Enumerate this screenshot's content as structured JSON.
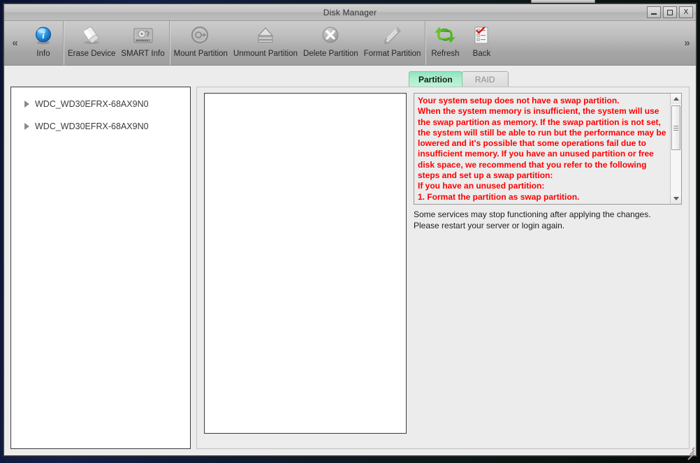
{
  "window": {
    "title": "Disk Manager",
    "buttons": {
      "minimize_label": "_",
      "maximize_label": "",
      "close_label": "X"
    }
  },
  "toolbar": {
    "scroll_left_label": "«",
    "scroll_right_label": "»",
    "groups": [
      {
        "items": [
          {
            "label": "Info",
            "icon": "info-icon"
          }
        ]
      },
      {
        "items": [
          {
            "label": "Erase Device",
            "icon": "eraser-icon"
          },
          {
            "label": "SMART Info",
            "icon": "harddisk-icon"
          }
        ]
      },
      {
        "items": [
          {
            "label": "Mount Partition",
            "icon": "plug-icon"
          },
          {
            "label": "Unmount Partition",
            "icon": "eject-icon"
          },
          {
            "label": "Delete Partition",
            "icon": "delete-circle-icon"
          },
          {
            "label": "Format Partition",
            "icon": "format-pencil-icon"
          }
        ]
      },
      {
        "items": [
          {
            "label": "Refresh",
            "icon": "refresh-icon"
          },
          {
            "label": "Back",
            "icon": "checklist-icon"
          }
        ]
      }
    ]
  },
  "tabs": [
    {
      "label": "Partition",
      "active": true
    },
    {
      "label": "RAID",
      "active": false
    }
  ],
  "tree": {
    "items": [
      {
        "label": "WDC_WD30EFRX-68AX9N0",
        "expanded": false
      },
      {
        "label": "WDC_WD30EFRX-68AX9N0",
        "expanded": false
      }
    ]
  },
  "warning": {
    "color": "#ff0000",
    "lines": [
      "Your system setup does not have a swap partition.",
      "When the system memory is insufficient, the system will use the swap partition as memory. If the swap partition is not set, the system will still be able to run but the performance may be lowered and it's possible that some operations fail due to insufficient memory. If you have an unused partition or free disk space, we recommend that you refer to the following steps and set up a swap partition:",
      "If you have an unused partition:",
      "1. Format the partition as swap partition."
    ]
  },
  "note": {
    "line1": "Some services may stop functioning after applying the changes.",
    "line2": "Please restart your server or login again."
  }
}
